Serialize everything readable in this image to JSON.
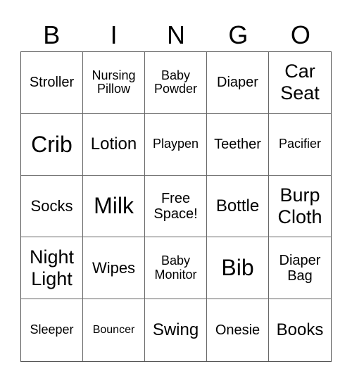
{
  "header": [
    "B",
    "I",
    "N",
    "G",
    "O"
  ],
  "cells": [
    "Stroller",
    "Nursing Pillow",
    "Baby Powder",
    "Diaper",
    "Car Seat",
    "Crib",
    "Lotion",
    "Playpen",
    "Teether",
    "Pacifier",
    "Socks",
    "Milk",
    "Free Space!",
    "Bottle",
    "Burp Cloth",
    "Night Light",
    "Wipes",
    "Baby Monitor",
    "Bib",
    "Diaper Bag",
    "Sleeper",
    "Bouncer",
    "Swing",
    "Onesie",
    "Books"
  ]
}
